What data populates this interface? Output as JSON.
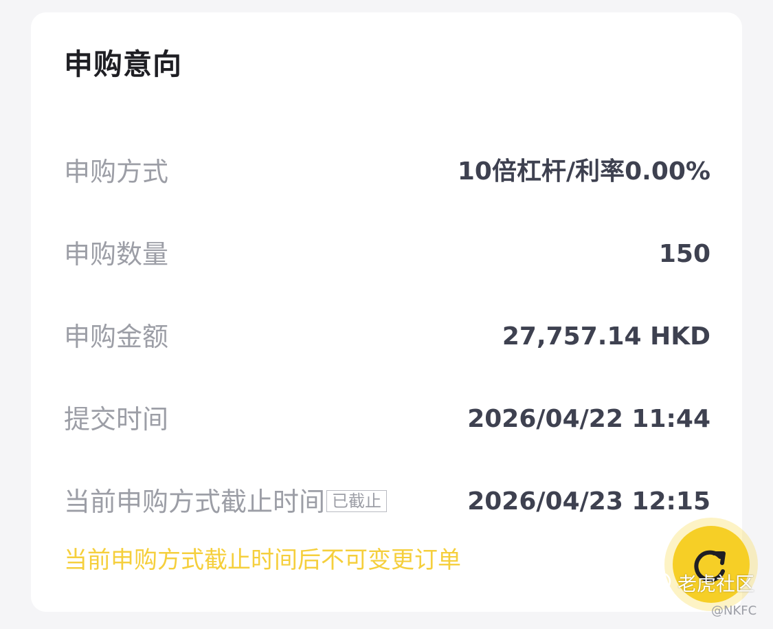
{
  "card": {
    "title": "申购意向",
    "rows": [
      {
        "label": "申购方式",
        "value": "10倍杠杆/利率0.00%"
      },
      {
        "label": "申购数量",
        "value": "150"
      },
      {
        "label": "申购金额",
        "value": "27,757.14 HKD"
      },
      {
        "label": "提交时间",
        "value": "2026/04/22 11:44"
      },
      {
        "label": "当前申购方式截止时间",
        "tag": "已截止",
        "value": "2026/04/23 12:15"
      }
    ],
    "notice": "当前申购方式截止时间后不可变更订单"
  },
  "fab": {
    "icon": "refresh-icon"
  },
  "watermark": {
    "text": "老虎社区",
    "handle": "@NKFC"
  },
  "colors": {
    "accent": "#f6cf26",
    "notice": "#f5cf3c",
    "label": "#9c9ea6",
    "value": "#3e4150"
  }
}
